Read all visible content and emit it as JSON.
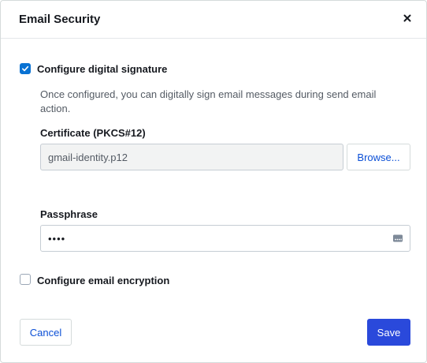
{
  "dialog": {
    "title": "Email Security"
  },
  "signature": {
    "label": "Configure digital signature",
    "checked": true,
    "description": "Once configured, you can digitally sign email messages during send email action.",
    "certificate": {
      "label": "Certificate (PKCS#12)",
      "value": "gmail-identity.p12",
      "browse_label": "Browse..."
    },
    "passphrase": {
      "label": "Passphrase",
      "value": "••••"
    }
  },
  "encryption": {
    "label": "Configure email encryption",
    "checked": false
  },
  "footer": {
    "cancel_label": "Cancel",
    "save_label": "Save"
  },
  "colors": {
    "accent": "#0972d3",
    "primary_button": "#2a49db",
    "link": "#0b4fd6"
  },
  "icons": {
    "close": "close-icon",
    "check": "check-icon",
    "password_manager": "password-key-icon"
  }
}
